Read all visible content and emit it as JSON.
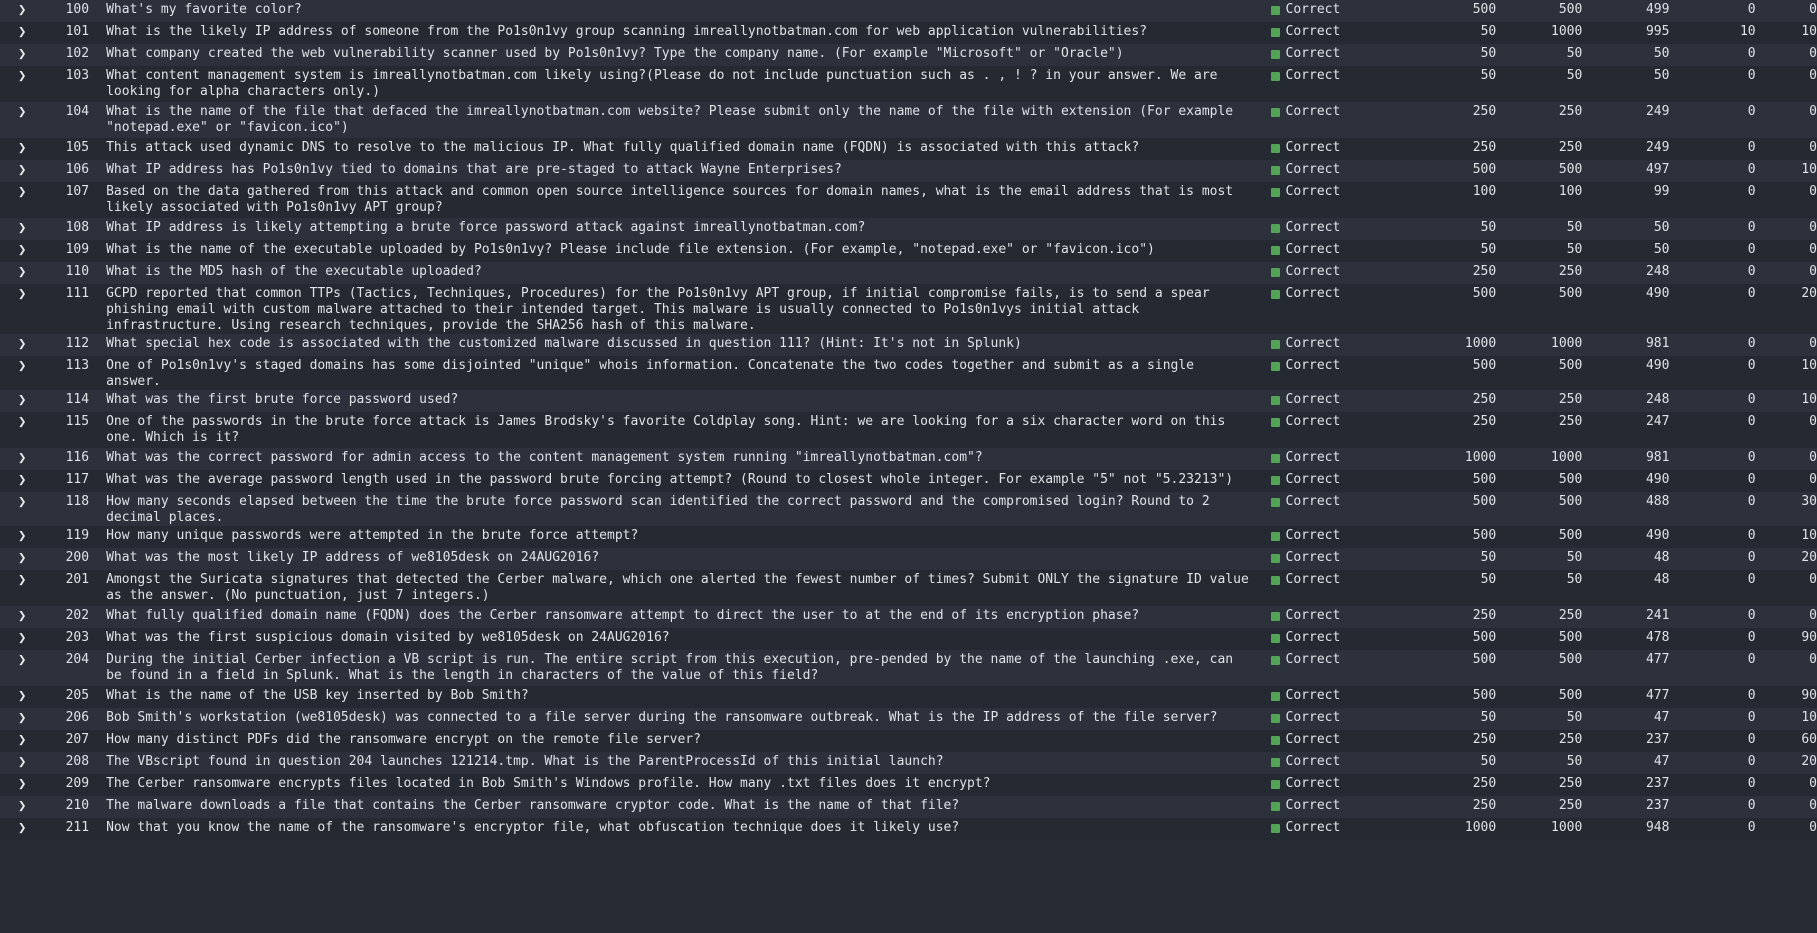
{
  "expand_icon": "chevron-right-icon",
  "status_color": "#53a457",
  "rows": [
    {
      "id": "100",
      "q": "What's my favorite color?",
      "status": "Correct",
      "c1": "500",
      "c2": "500",
      "c3": "499",
      "c4": "0",
      "c5": "0"
    },
    {
      "id": "101",
      "q": "What is the likely IP address of someone from the Po1s0n1vy group scanning imreallynotbatman.com for web application vulnerabilities?",
      "status": "Correct",
      "c1": "50",
      "c2": "1000",
      "c3": "995",
      "c4": "10",
      "c5": "10"
    },
    {
      "id": "102",
      "q": "What company created the web vulnerability scanner used by Po1s0n1vy? Type the company name. (For example \"Microsoft\" or \"Oracle\")",
      "status": "Correct",
      "c1": "50",
      "c2": "50",
      "c3": "50",
      "c4": "0",
      "c5": "0"
    },
    {
      "id": "103",
      "q": "What content management system is imreallynotbatman.com likely using?(Please do not include punctuation such as . , ! ? in your answer. We are looking for alpha characters only.)",
      "status": "Correct",
      "c1": "50",
      "c2": "50",
      "c3": "50",
      "c4": "0",
      "c5": "0"
    },
    {
      "id": "104",
      "q": "What is the name of the file that defaced the imreallynotbatman.com website? Please submit only the name of the file with extension (For example \"notepad.exe\" or \"favicon.ico\")",
      "status": "Correct",
      "c1": "250",
      "c2": "250",
      "c3": "249",
      "c4": "0",
      "c5": "0"
    },
    {
      "id": "105",
      "q": "This attack used dynamic DNS to resolve to the malicious IP. What fully qualified domain name (FQDN) is associated with this attack?",
      "status": "Correct",
      "c1": "250",
      "c2": "250",
      "c3": "249",
      "c4": "0",
      "c5": "0"
    },
    {
      "id": "106",
      "q": "What IP address has Po1s0n1vy tied to domains that are pre-staged to attack Wayne Enterprises?",
      "status": "Correct",
      "c1": "500",
      "c2": "500",
      "c3": "497",
      "c4": "0",
      "c5": "10"
    },
    {
      "id": "107",
      "q": "Based on the data gathered from this attack and common open source intelligence sources for domain names, what is the email address that is most likely associated with Po1s0n1vy APT group?",
      "status": "Correct",
      "c1": "100",
      "c2": "100",
      "c3": "99",
      "c4": "0",
      "c5": "0"
    },
    {
      "id": "108",
      "q": "What IP address is likely attempting a brute force password attack against imreallynotbatman.com?",
      "status": "Correct",
      "c1": "50",
      "c2": "50",
      "c3": "50",
      "c4": "0",
      "c5": "0"
    },
    {
      "id": "109",
      "q": "What is the name of the executable uploaded by Po1s0n1vy? Please include file extension. (For example, \"notepad.exe\" or \"favicon.ico\")",
      "status": "Correct",
      "c1": "50",
      "c2": "50",
      "c3": "50",
      "c4": "0",
      "c5": "0"
    },
    {
      "id": "110",
      "q": "What is the MD5 hash of the executable uploaded?",
      "status": "Correct",
      "c1": "250",
      "c2": "250",
      "c3": "248",
      "c4": "0",
      "c5": "0"
    },
    {
      "id": "111",
      "q": "GCPD reported that common TTPs (Tactics, Techniques, Procedures) for the Po1s0n1vy APT group, if initial compromise fails, is to send a spear phishing email with custom malware attached to their intended target. This malware is usually connected to Po1s0n1vys initial attack infrastructure. Using research techniques, provide the SHA256 hash of this malware.",
      "status": "Correct",
      "c1": "500",
      "c2": "500",
      "c3": "490",
      "c4": "0",
      "c5": "20"
    },
    {
      "id": "112",
      "q": "What special hex code is associated with the customized malware discussed in question 111? (Hint: It's not in Splunk)",
      "status": "Correct",
      "c1": "1000",
      "c2": "1000",
      "c3": "981",
      "c4": "0",
      "c5": "0"
    },
    {
      "id": "113",
      "q": "One of Po1s0n1vy's staged domains has some disjointed \"unique\" whois information. Concatenate the two codes together and submit as a single answer.",
      "status": "Correct",
      "c1": "500",
      "c2": "500",
      "c3": "490",
      "c4": "0",
      "c5": "10"
    },
    {
      "id": "114",
      "q": "What was the first brute force password used?",
      "status": "Correct",
      "c1": "250",
      "c2": "250",
      "c3": "248",
      "c4": "0",
      "c5": "10"
    },
    {
      "id": "115",
      "q": "One of the passwords in the brute force attack is James Brodsky's favorite Coldplay song. Hint: we are looking for a six character word on this one. Which is it?",
      "status": "Correct",
      "c1": "250",
      "c2": "250",
      "c3": "247",
      "c4": "0",
      "c5": "0"
    },
    {
      "id": "116",
      "q": "What was the correct password for admin access to the content management system running \"imreallynotbatman.com\"?",
      "status": "Correct",
      "c1": "1000",
      "c2": "1000",
      "c3": "981",
      "c4": "0",
      "c5": "0"
    },
    {
      "id": "117",
      "q": "What was the average password length used in the password brute forcing attempt? (Round to closest whole integer. For example \"5\" not \"5.23213\")",
      "status": "Correct",
      "c1": "500",
      "c2": "500",
      "c3": "490",
      "c4": "0",
      "c5": "0"
    },
    {
      "id": "118",
      "q": "How many seconds elapsed between the time the brute force password scan identified the correct password and the compromised login? Round to 2 decimal places.",
      "status": "Correct",
      "c1": "500",
      "c2": "500",
      "c3": "488",
      "c4": "0",
      "c5": "30"
    },
    {
      "id": "119",
      "q": "How many unique passwords were attempted in the brute force attempt?",
      "status": "Correct",
      "c1": "500",
      "c2": "500",
      "c3": "490",
      "c4": "0",
      "c5": "10"
    },
    {
      "id": "200",
      "q": "What was the most likely IP address of we8105desk on 24AUG2016?",
      "status": "Correct",
      "c1": "50",
      "c2": "50",
      "c3": "48",
      "c4": "0",
      "c5": "20"
    },
    {
      "id": "201",
      "q": "Amongst the Suricata signatures that detected the Cerber malware, which one alerted the fewest number of times? Submit ONLY the signature ID value as the answer. (No punctuation, just 7 integers.)",
      "status": "Correct",
      "c1": "50",
      "c2": "50",
      "c3": "48",
      "c4": "0",
      "c5": "0"
    },
    {
      "id": "202",
      "q": "What fully qualified domain name (FQDN) does the Cerber ransomware attempt to direct the user to at the end of its encryption phase?",
      "status": "Correct",
      "c1": "250",
      "c2": "250",
      "c3": "241",
      "c4": "0",
      "c5": "0"
    },
    {
      "id": "203",
      "q": "What was the first suspicious domain visited by we8105desk on 24AUG2016?",
      "status": "Correct",
      "c1": "500",
      "c2": "500",
      "c3": "478",
      "c4": "0",
      "c5": "90"
    },
    {
      "id": "204",
      "q": "During the initial Cerber infection a VB script is run. The entire script from this execution, pre-pended by the name of the launching .exe, can be found in a field in Splunk. What is the length in characters of the value of this field?",
      "status": "Correct",
      "c1": "500",
      "c2": "500",
      "c3": "477",
      "c4": "0",
      "c5": "0"
    },
    {
      "id": "205",
      "q": "What is the name of the USB key inserted by Bob Smith?",
      "status": "Correct",
      "c1": "500",
      "c2": "500",
      "c3": "477",
      "c4": "0",
      "c5": "90"
    },
    {
      "id": "206",
      "q": "Bob Smith's workstation (we8105desk) was connected to a file server during the ransomware outbreak. What is the IP address of the file server?",
      "status": "Correct",
      "c1": "50",
      "c2": "50",
      "c3": "47",
      "c4": "0",
      "c5": "10"
    },
    {
      "id": "207",
      "q": "How many distinct PDFs did the ransomware encrypt on the remote file server?",
      "status": "Correct",
      "c1": "250",
      "c2": "250",
      "c3": "237",
      "c4": "0",
      "c5": "60"
    },
    {
      "id": "208",
      "q": "The VBscript found in question 204 launches 121214.tmp. What is the ParentProcessId of this initial launch?",
      "status": "Correct",
      "c1": "50",
      "c2": "50",
      "c3": "47",
      "c4": "0",
      "c5": "20"
    },
    {
      "id": "209",
      "q": "The Cerber ransomware encrypts files located in Bob Smith's Windows profile. How many .txt files does it encrypt?",
      "status": "Correct",
      "c1": "250",
      "c2": "250",
      "c3": "237",
      "c4": "0",
      "c5": "0"
    },
    {
      "id": "210",
      "q": "The malware downloads a file that contains the Cerber ransomware cryptor code. What is the name of that file?",
      "status": "Correct",
      "c1": "250",
      "c2": "250",
      "c3": "237",
      "c4": "0",
      "c5": "0"
    },
    {
      "id": "211",
      "q": "Now that you know the name of the ransomware's encryptor file, what obfuscation technique does it likely use?",
      "status": "Correct",
      "c1": "1000",
      "c2": "1000",
      "c3": "948",
      "c4": "0",
      "c5": "0"
    }
  ]
}
